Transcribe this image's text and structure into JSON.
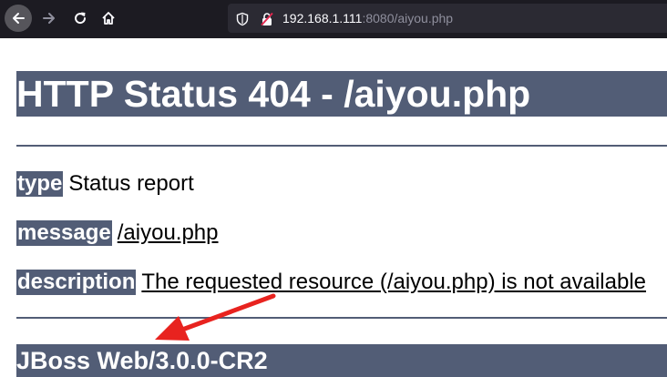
{
  "browser": {
    "url_host": "192.168.1.111",
    "url_rest": ":8080/aiyou.php",
    "icons": {
      "back": "back-arrow-icon",
      "forward": "forward-arrow-icon",
      "reload": "reload-icon",
      "home": "home-icon",
      "shield": "shield-icon",
      "insecure": "insecure-lock-icon"
    }
  },
  "page": {
    "title": "HTTP Status 404 - /aiyou.php",
    "type_label": "type",
    "type_value": "Status report",
    "message_label": "message",
    "message_value": "/aiyou.php",
    "description_label": "description",
    "description_value": "The requested resource (/aiyou.php) is not available",
    "footer": "JBoss Web/3.0.0-CR2"
  },
  "annotation": {
    "color": "#e8231f",
    "shape": "arrow"
  },
  "colors": {
    "header_bg": "#525d76",
    "toolbar_bg": "#1c1b22",
    "urlbar_bg": "#2b2a33"
  }
}
